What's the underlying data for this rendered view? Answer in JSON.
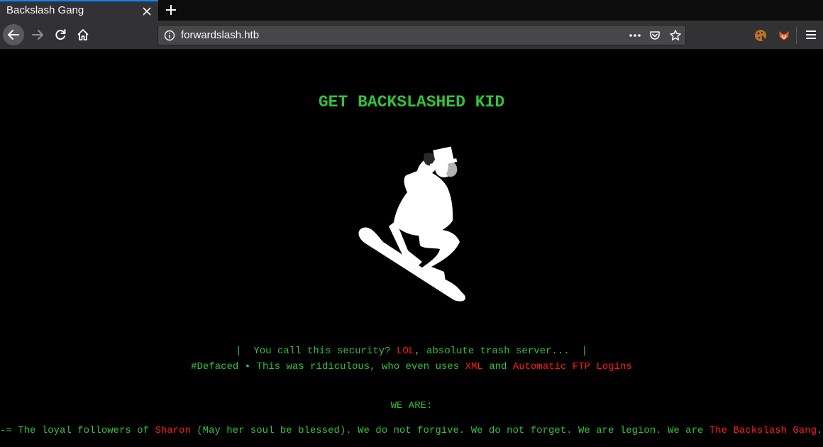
{
  "browser": {
    "tab_title": "Backslash Gang",
    "url": "forwardslash.htb"
  },
  "page": {
    "headline": "GET BACKSLASHED KID",
    "line1": {
      "prefix": "|  You call this security? ",
      "highlight": "LOL",
      "suffix": ", absolute trash server...  |"
    },
    "line2": {
      "prefix": "#Defaced • This was ridiculous, who even uses ",
      "highlight1": "XML",
      "middle": " and ",
      "highlight2": "Automatic FTP Logins"
    },
    "line3": "WE ARE:",
    "line4": {
      "prefix": "-= The loyal followers of ",
      "highlight1": "Sharon",
      "middle": " (May her soul be blessed). We do not forgive. We do not forget. We are legion. We are ",
      "highlight2": "The Backslash Gang",
      "suffix": ". =-"
    }
  },
  "icons": {
    "tab_close": "close-icon",
    "new_tab": "plus-icon",
    "back": "arrow-left-icon",
    "forward": "arrow-right-icon",
    "reload": "reload-icon",
    "home": "home-icon",
    "site_info": "info-icon",
    "page_actions": "ellipsis-icon",
    "pocket": "pocket-icon",
    "bookmark": "star-icon",
    "extension_1": "cookie-icon",
    "extension_2": "foxy-extension-icon",
    "menu": "hamburger-menu-icon",
    "logo": "snowboarder-top-hat-logo"
  },
  "colors": {
    "text_green": "#34c13b",
    "text_red": "#ff1a1a",
    "page_background": "#000000",
    "toolbar": "#323234",
    "tab_accent": "#0a84ff"
  }
}
